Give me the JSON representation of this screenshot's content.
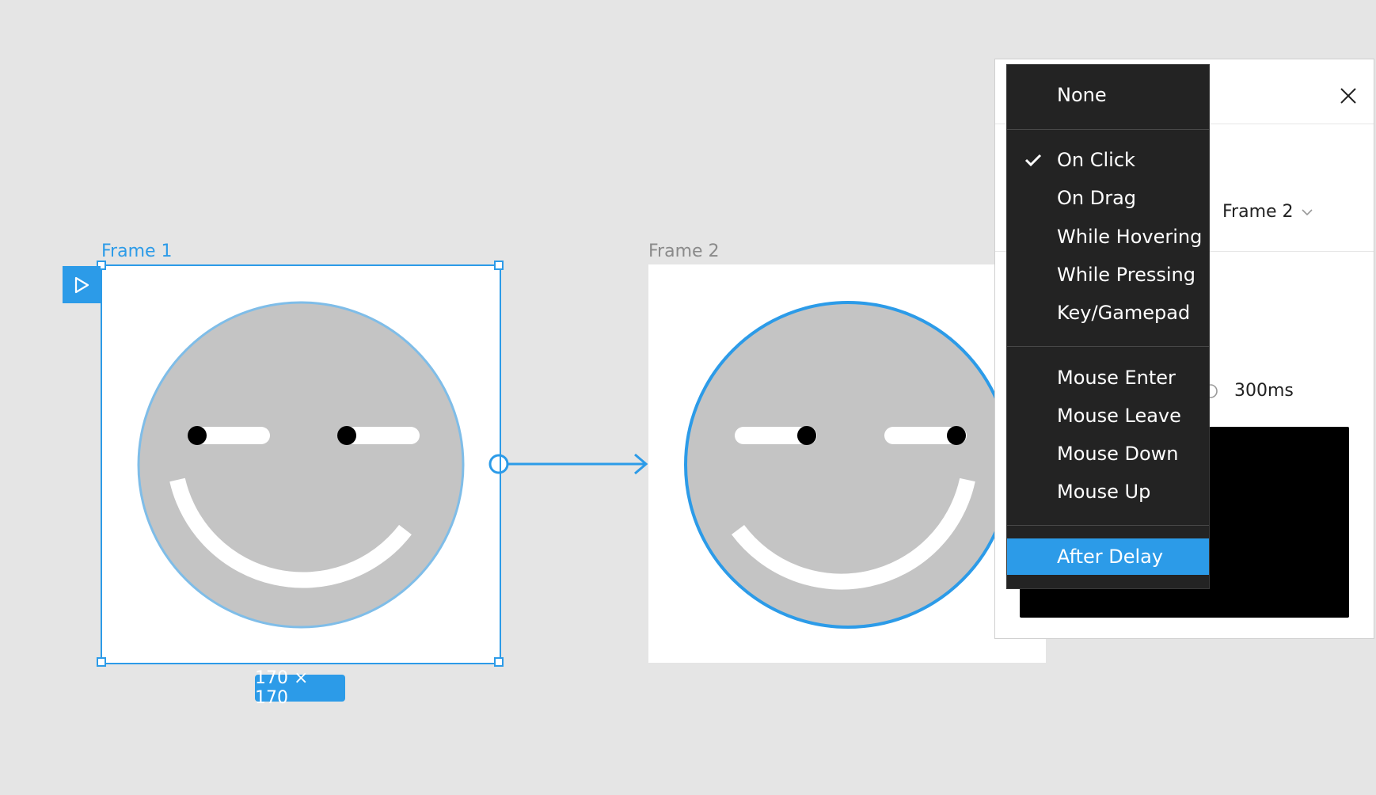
{
  "canvas": {
    "frame1": {
      "label": "Frame 1",
      "size_badge": "170 × 170"
    },
    "frame2": {
      "label": "Frame 2"
    }
  },
  "panel": {
    "destination": {
      "value": "Frame 2"
    },
    "duration": {
      "value": "300ms"
    }
  },
  "trigger_menu": {
    "selected": "After Delay",
    "checked": "On Click",
    "items": [
      "None",
      "On Click",
      "On Drag",
      "While Hovering",
      "While Pressing",
      "Key/Gamepad",
      "Mouse Enter",
      "Mouse Leave",
      "Mouse Down",
      "Mouse Up",
      "After Delay"
    ]
  },
  "colors": {
    "accent": "#2c9be8",
    "canvas_bg": "#e5e5e5",
    "face_fill": "#c4c4c4",
    "menu_bg": "#232323"
  }
}
